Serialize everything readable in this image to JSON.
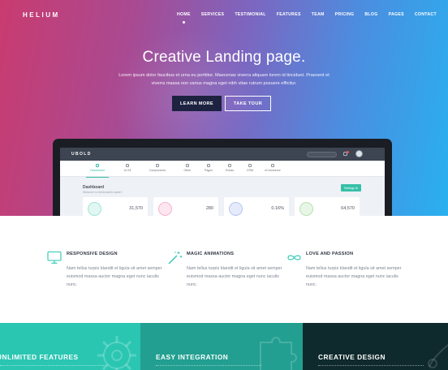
{
  "nav": {
    "logo": "HELIUM",
    "items": [
      {
        "label": "HOME"
      },
      {
        "label": "SERVICES"
      },
      {
        "label": "TESTIMONIAL"
      },
      {
        "label": "FEATURES"
      },
      {
        "label": "TEAM"
      },
      {
        "label": "PRICING"
      },
      {
        "label": "BLOG"
      },
      {
        "label": "PAGES"
      },
      {
        "label": "CONTACT"
      }
    ],
    "active": "HOME"
  },
  "hero": {
    "title": "Creative Landing page.",
    "subtitle": "Lorem ipsum dolor faucibus et urna eu porttitor. Maecenas viverra aliquam lorem id tincidunt. Praesent et viverra massa non varius magna eget nibh vitae rutrum posuere efficitur.",
    "learn_more": "LEARN MORE",
    "take_tour": "TAKE TOUR"
  },
  "dashboard_mock": {
    "logo": "UBOLD",
    "menu": [
      "Dashboard",
      "UI Kit",
      "Components",
      "Other",
      "Pages",
      "Extras",
      "CRM",
      "eCommerce"
    ],
    "title": "Dashboard",
    "subtitle": "Welcome to Ubold admin panel !",
    "settings_label": "Settings",
    "stats": [
      "31,570",
      "280",
      "0.16%",
      "64,570"
    ],
    "colors": {
      "accent": "#36c0a8"
    }
  },
  "features": [
    {
      "title": "RESPONSIVE DESIGN",
      "icon": "monitor-icon",
      "text": "Nam tellus turpis blandit et ligula sit amet semper euismod massa auctor magna eget nunc iaculis nunc."
    },
    {
      "title": "MAGIC ANIMATIONS",
      "icon": "magic-wand-icon",
      "text": "Nam tellus turpis blandit et ligula sit amet semper euismod massa auctor magna eget nunc iaculis nunc."
    },
    {
      "title": "LOVE AND PASSION",
      "icon": "infinity-icon",
      "text": "Nam tellus turpis blandit et ligula sit amet semper euismod massa auctor magna eget nunc iaculis nunc."
    }
  ],
  "panels": [
    {
      "title": "UNLIMITED FEATURES",
      "color": "#2ac6b2"
    },
    {
      "title": "EASY INTEGRATION",
      "color": "#229f90"
    },
    {
      "title": "CREATIVE DESIGN",
      "color": "#0f2a2c"
    }
  ],
  "colors": {
    "hero_gradient_start": "#c93b6f",
    "hero_gradient_end": "#29b0ef",
    "accent": "#2ac6b2",
    "dark_button": "#1c2240"
  }
}
